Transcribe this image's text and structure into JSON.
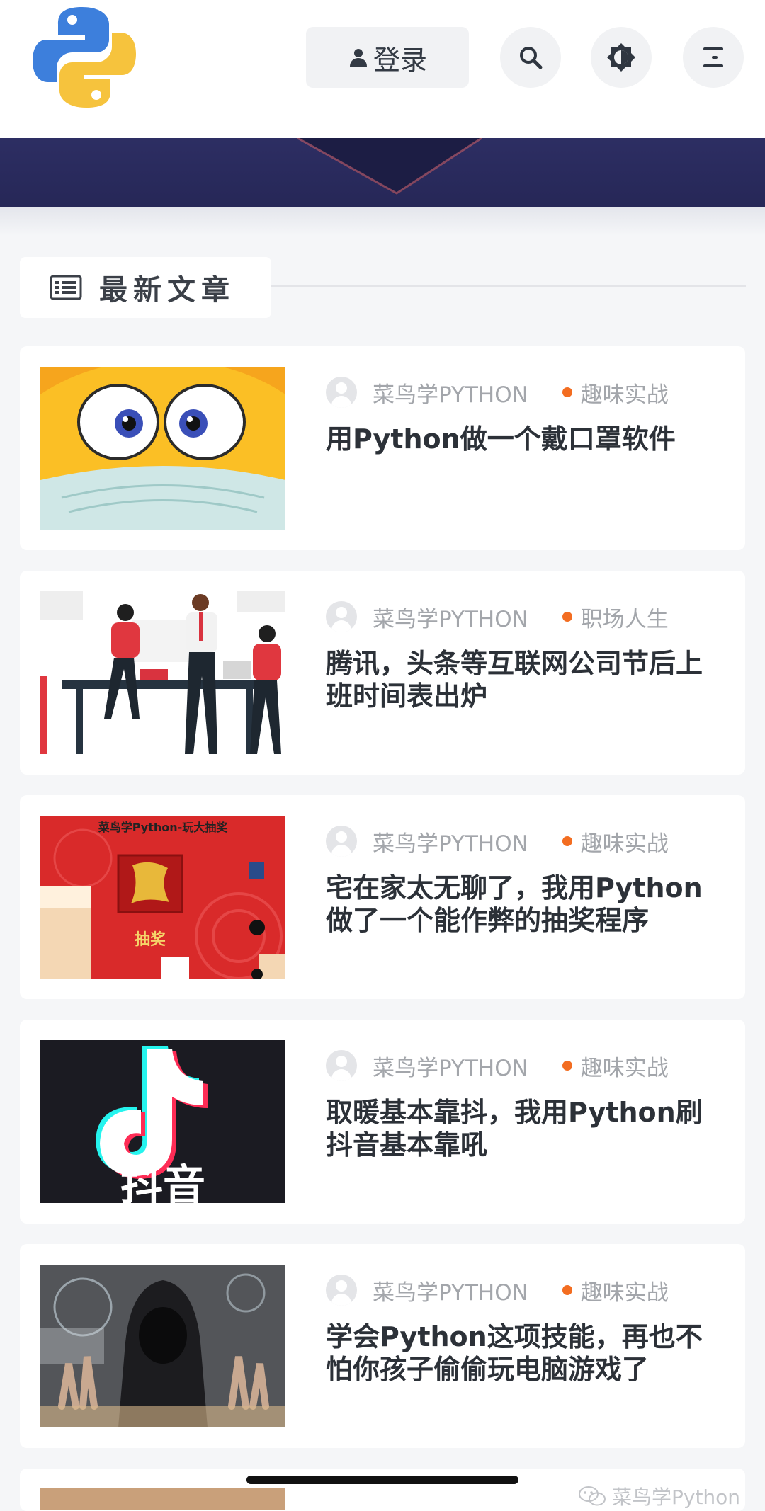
{
  "header": {
    "login_label": "登录"
  },
  "section": {
    "title": "最新文章"
  },
  "articles": [
    {
      "author": "菜鸟学PYTHON",
      "category": "趣味实战",
      "title": "用Python做一个戴口罩软件",
      "thumb": "emoji-mask"
    },
    {
      "author": "菜鸟学PYTHON",
      "category": "职场人生",
      "title": "腾讯，头条等互联网公司节后上班时间表出炉",
      "thumb": "office-people"
    },
    {
      "author": "菜鸟学PYTHON",
      "category": "趣味实战",
      "title": "宅在家太无聊了，我用Python做了一个能作弊的抽奖程序",
      "thumb": "lottery-app",
      "thumb_caption": "菜鸟学Python-玩大抽奖",
      "thumb_button": "抽奖"
    },
    {
      "author": "菜鸟学PYTHON",
      "category": "趣味实战",
      "title": "取暖基本靠抖，我用Python刷抖音基本靠吼",
      "thumb": "douyin-logo",
      "thumb_caption": "抖音"
    },
    {
      "author": "菜鸟学PYTHON",
      "category": "趣味实战",
      "title": "学会Python这项技能，再也不怕你孩子偷偷玩电脑游戏了",
      "thumb": "hacker-hood"
    }
  ],
  "watermark": {
    "text": "菜鸟学Python"
  },
  "colors": {
    "accent_dot": "#f36d21",
    "banner": "#2d2e63"
  }
}
